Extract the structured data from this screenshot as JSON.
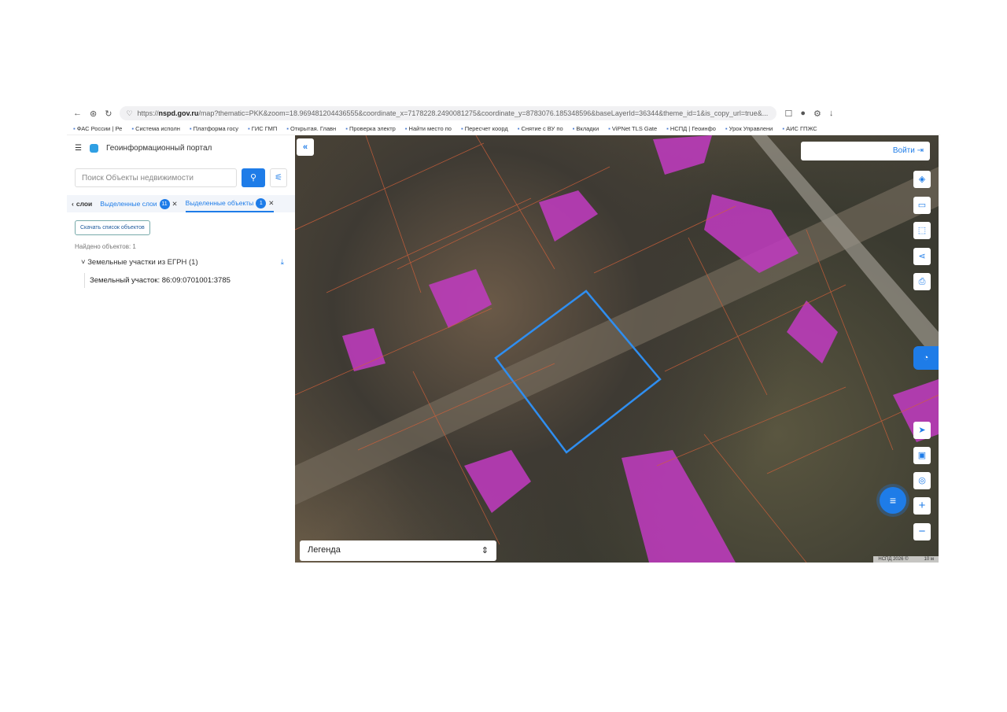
{
  "browser": {
    "url_prefix": "https://",
    "url_host": "nspd.gov.ru",
    "url_rest": "/map?thematic=PKK&zoom=18.969481204436555&coordinate_x=7178228.2490081275&coordinate_y=8783076.185348596&baseLayerId=36344&theme_id=1&is_copy_url=true&..."
  },
  "bookmarks": [
    "ФАС России | Ре",
    "Система исполн",
    "Платформа госу",
    "ГИС ГМП",
    "Открытая. Главн",
    "Проверка электр",
    "Найти место по",
    "Пересчет коорд",
    "Снятие с ВУ по",
    "Вкладки",
    "ViPNet TLS Gate",
    "НСПД | Геоинфо",
    "Урок Управлени",
    "АИС ГПЖС"
  ],
  "sidebar": {
    "title": "Геоинформационный портал",
    "search_placeholder": "Поиск Объекты недвижимости",
    "tabs": [
      {
        "label": "слои"
      },
      {
        "label": "Выделенные слои",
        "count": "11"
      },
      {
        "label": "Выделенные объекты",
        "count": "1"
      }
    ],
    "download_label": "Скачать список объектов",
    "found": "Найдено объектов: 1",
    "group": "Земельные участки из ЕГРН (1)",
    "item": "Земельный участок: 86:09:0701001:3785"
  },
  "map": {
    "login": "Войти",
    "legend": "Легенда",
    "copyright": "НСПД 2026 ©",
    "scale": "10 м"
  }
}
